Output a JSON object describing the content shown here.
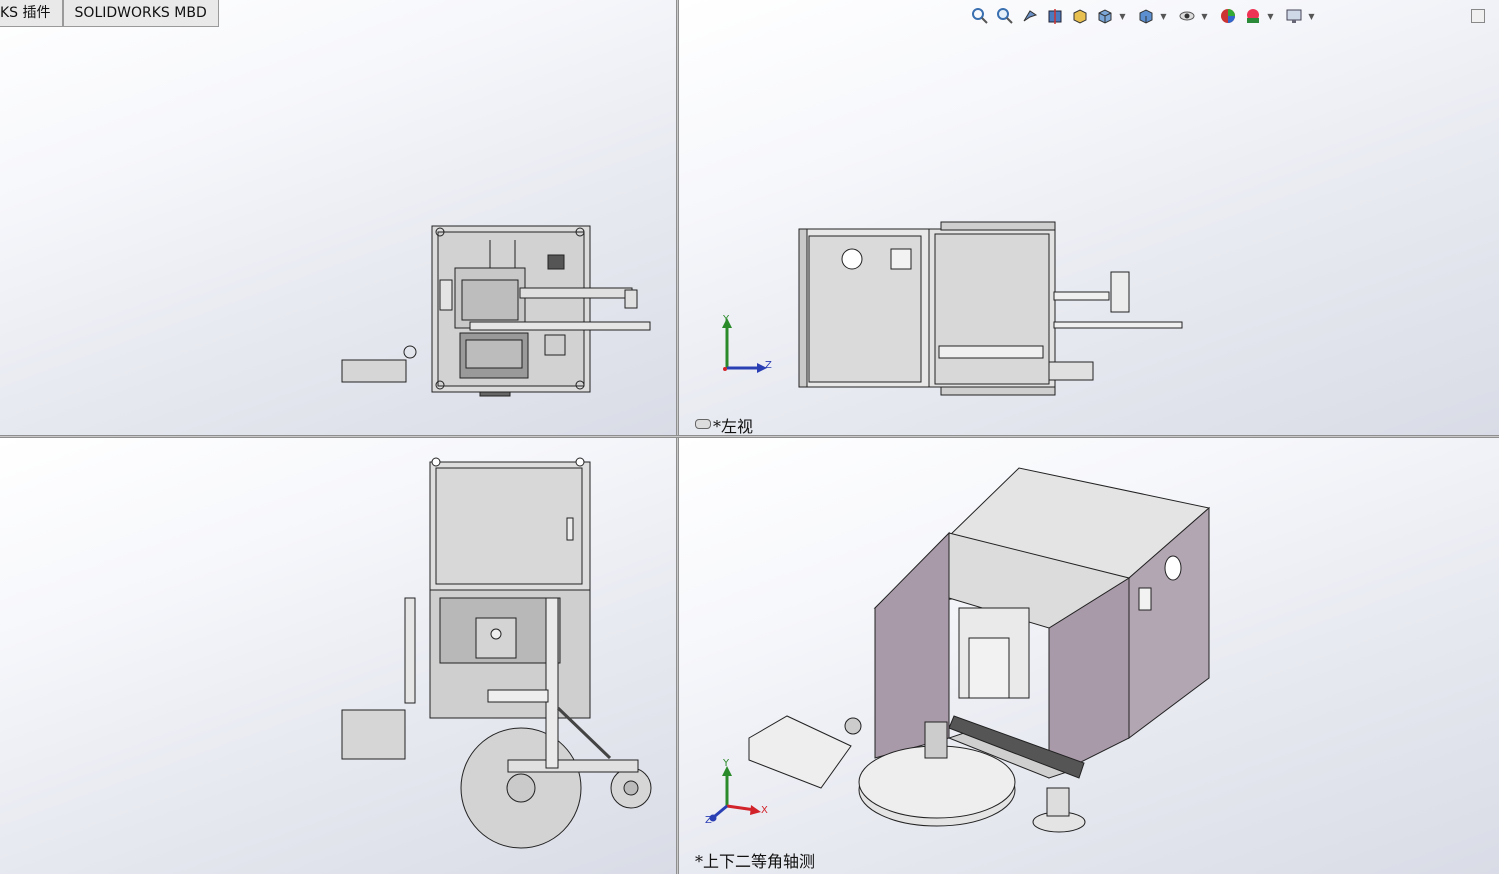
{
  "tabs": [
    {
      "label": "KS 插件"
    },
    {
      "label": "SOLIDWORKS MBD"
    }
  ],
  "views": {
    "top_right": {
      "label": "*左视"
    },
    "bottom_right": {
      "label": "*上下二等角轴测"
    }
  },
  "axes": {
    "x": "X",
    "y": "Y",
    "z": "Z"
  },
  "toolbar": {
    "icons": [
      "zoom-to-fit-icon",
      "zoom-to-area-icon",
      "previous-view-icon",
      "section-view-icon",
      "view-selector-icon",
      "view-orientation-icon",
      "display-style-icon",
      "hide-show-items-icon",
      "edit-appearance-icon",
      "apply-scene-icon",
      "view-settings-icon"
    ]
  },
  "colors": {
    "axis_x": "#d2232a",
    "axis_y": "#2a8a2a",
    "axis_z": "#2b3fb5",
    "panel_purple": "#a89aa8"
  }
}
